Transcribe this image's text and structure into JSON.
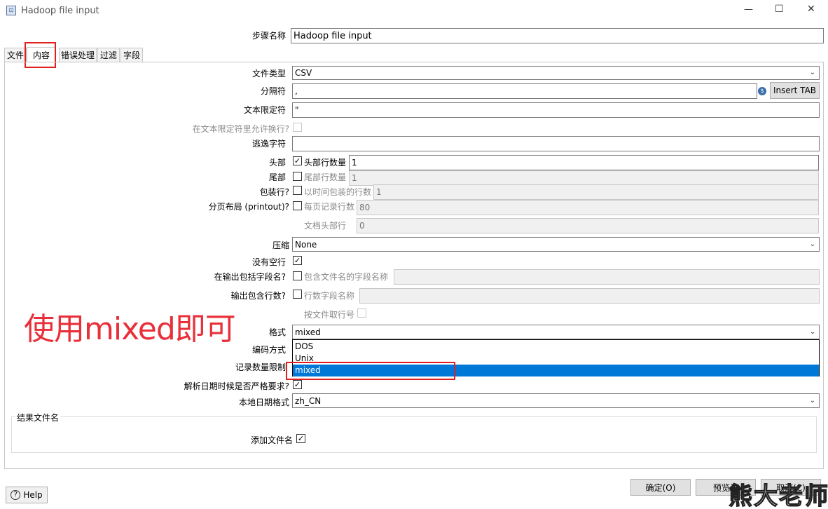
{
  "window": {
    "title": "Hadoop file input",
    "controls": {
      "minimize": "—",
      "maximize": "☐",
      "close": "✕"
    }
  },
  "step": {
    "label": "步骤名称",
    "value": "Hadoop file input"
  },
  "tabs": [
    "文件",
    "内容",
    "错误处理",
    "过滤",
    "字段"
  ],
  "content": {
    "file_type": {
      "label": "文件类型",
      "value": "CSV"
    },
    "separator": {
      "label": "分隔符",
      "value": ",",
      "insert_tab": "Insert TAB"
    },
    "enclosure": {
      "label": "文本限定符",
      "value": "\""
    },
    "allow_breaks": {
      "label": "在文本限定符里允许换行?"
    },
    "escape": {
      "label": "逃逸字符",
      "value": ""
    },
    "header": {
      "label": "头部",
      "check_label": "头部行数量",
      "value": "1"
    },
    "footer": {
      "label": "尾部",
      "check_label": "尾部行数量",
      "value": "1"
    },
    "wrap": {
      "label": "包装行?",
      "check_label": "以时间包装的行数",
      "value": "1"
    },
    "paged": {
      "label": "分页布局 (printout)?",
      "check_label": "每页记录行数",
      "value": "80",
      "doc_header_label": "文档头部行",
      "doc_header_value": "0"
    },
    "compression": {
      "label": "压缩",
      "value": "None"
    },
    "no_empty": {
      "label": "没有空行"
    },
    "include_filename": {
      "label": "在输出包括字段名?",
      "check_label": "包含文件名的字段名称"
    },
    "include_rownum": {
      "label": "输出包含行数?",
      "check_label": "行数字段名称",
      "by_file_label": "按文件取行号"
    },
    "format": {
      "label": "格式",
      "value": "mixed",
      "options": [
        "DOS",
        "Unix",
        "mixed"
      ]
    },
    "encoding": {
      "label": "编码方式"
    },
    "limit": {
      "label": "记录数量限制"
    },
    "lenient_date": {
      "label": "解析日期时候是否严格要求?"
    },
    "locale": {
      "label": "本地日期格式",
      "value": "zh_CN"
    }
  },
  "result_filename": {
    "group_label": "结果文件名",
    "add_filename_label": "添加文件名"
  },
  "annotation": {
    "text": "使用mixed即可",
    "color": "#e8303a"
  },
  "footer": {
    "help": "Help",
    "ok": "确定(O)",
    "preview": "预览记",
    "cancel": "取消(C)",
    "watermark": "熊大老师"
  },
  "colors": {
    "selection": "#0078d7",
    "highlight_box": "#e02020"
  }
}
